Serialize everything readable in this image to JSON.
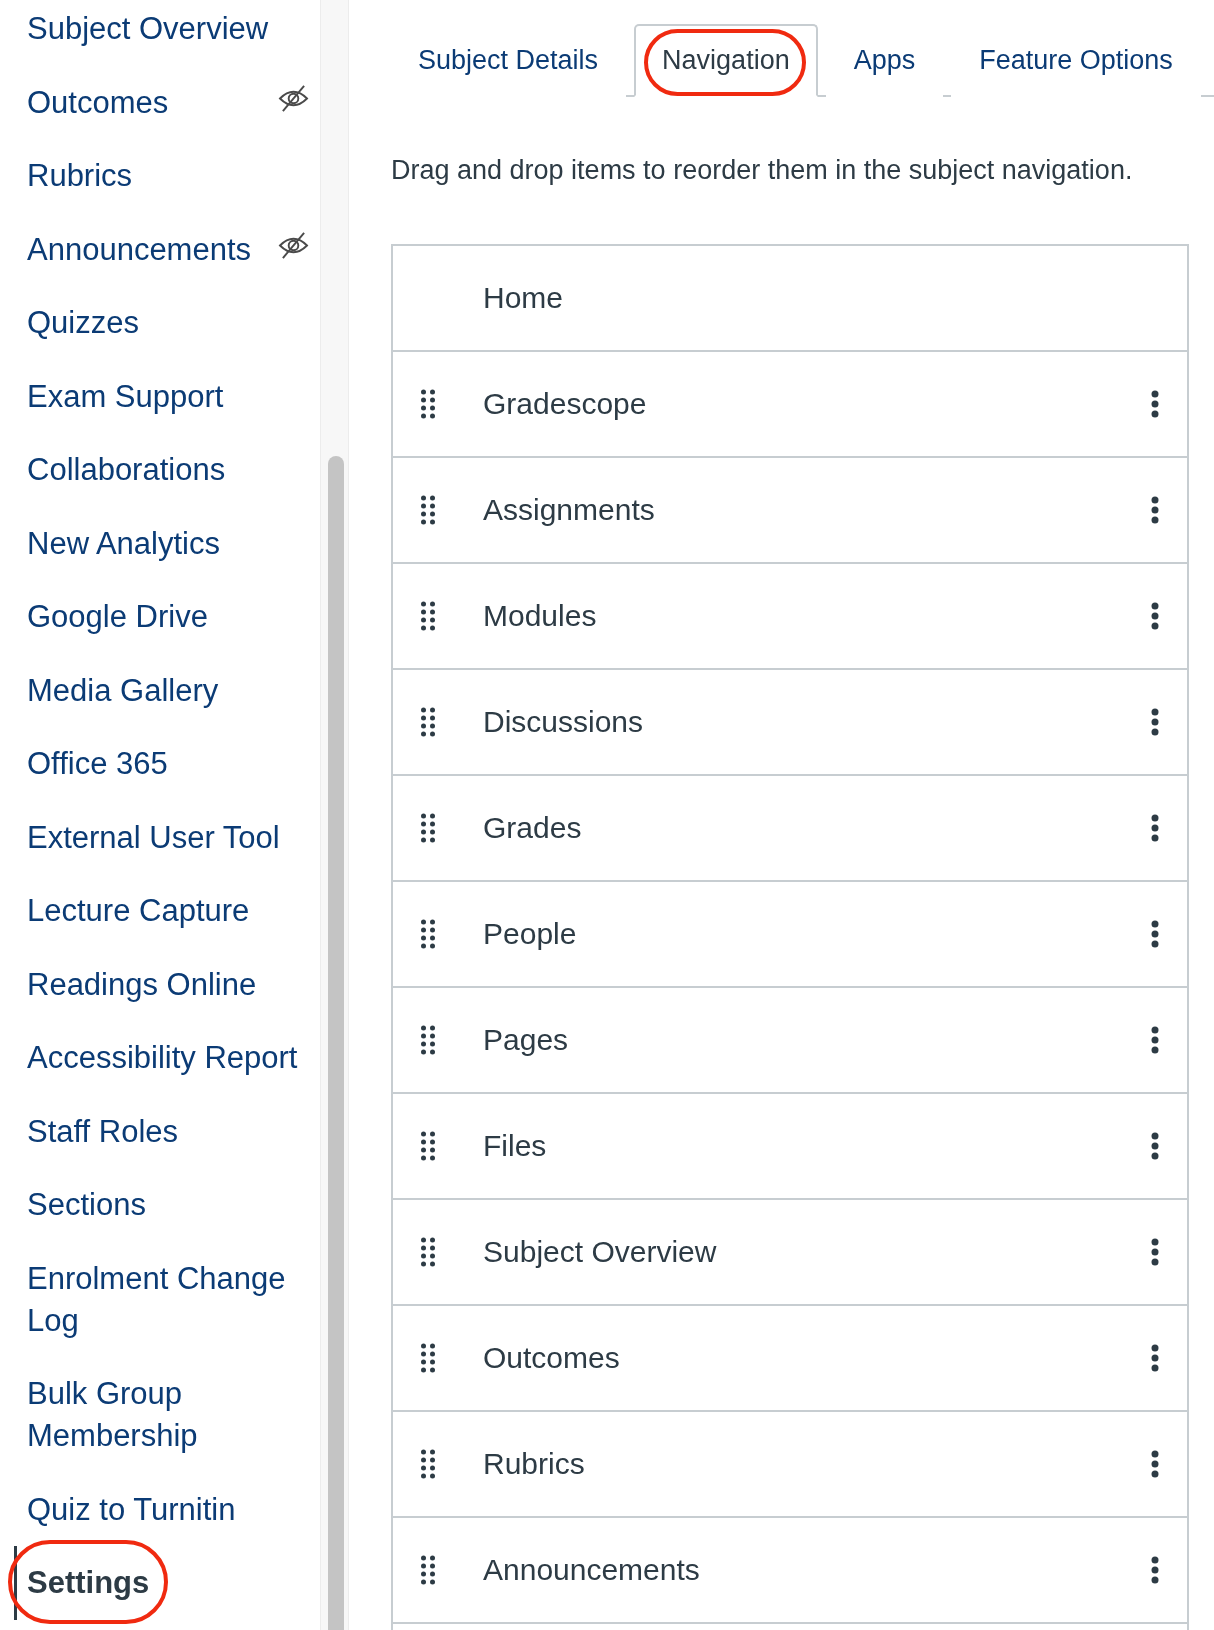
{
  "sidebar": {
    "items": [
      {
        "label": "Subject Overview",
        "hidden": false,
        "selected": false,
        "circled": false
      },
      {
        "label": "Outcomes",
        "hidden": true,
        "selected": false,
        "circled": false
      },
      {
        "label": "Rubrics",
        "hidden": false,
        "selected": false,
        "circled": false
      },
      {
        "label": "Announcements",
        "hidden": true,
        "selected": false,
        "circled": false
      },
      {
        "label": "Quizzes",
        "hidden": false,
        "selected": false,
        "circled": false
      },
      {
        "label": "Exam Support",
        "hidden": false,
        "selected": false,
        "circled": false
      },
      {
        "label": "Collaborations",
        "hidden": false,
        "selected": false,
        "circled": false
      },
      {
        "label": "New Analytics",
        "hidden": false,
        "selected": false,
        "circled": false
      },
      {
        "label": "Google Drive",
        "hidden": false,
        "selected": false,
        "circled": false
      },
      {
        "label": "Media Gallery",
        "hidden": false,
        "selected": false,
        "circled": false
      },
      {
        "label": "Office 365",
        "hidden": false,
        "selected": false,
        "circled": false
      },
      {
        "label": "External User Tool",
        "hidden": false,
        "selected": false,
        "circled": false
      },
      {
        "label": "Lecture Capture",
        "hidden": false,
        "selected": false,
        "circled": false
      },
      {
        "label": "Readings Online",
        "hidden": false,
        "selected": false,
        "circled": false
      },
      {
        "label": "Accessibility Report",
        "hidden": false,
        "selected": false,
        "circled": false
      },
      {
        "label": "Staff Roles",
        "hidden": false,
        "selected": false,
        "circled": false
      },
      {
        "label": "Sections",
        "hidden": false,
        "selected": false,
        "circled": false
      },
      {
        "label": "Enrolment Change Log",
        "hidden": false,
        "selected": false,
        "circled": false
      },
      {
        "label": "Bulk Group Membership",
        "hidden": false,
        "selected": false,
        "circled": false
      },
      {
        "label": "Quiz to Turnitin",
        "hidden": false,
        "selected": false,
        "circled": false
      },
      {
        "label": "Settings",
        "hidden": false,
        "selected": true,
        "circled": true
      }
    ]
  },
  "tabs": [
    {
      "label": "Subject Details",
      "selected": false,
      "circled": false
    },
    {
      "label": "Navigation",
      "selected": true,
      "circled": true
    },
    {
      "label": "Apps",
      "selected": false,
      "circled": false
    },
    {
      "label": "Feature Options",
      "selected": false,
      "circled": false
    }
  ],
  "description": "Drag and drop items to reorder them in the subject navigation.",
  "navigation_items": [
    {
      "label": "Home",
      "draggable": false
    },
    {
      "label": "Gradescope",
      "draggable": true
    },
    {
      "label": "Assignments",
      "draggable": true
    },
    {
      "label": "Modules",
      "draggable": true
    },
    {
      "label": "Discussions",
      "draggable": true
    },
    {
      "label": "Grades",
      "draggable": true
    },
    {
      "label": "People",
      "draggable": true
    },
    {
      "label": "Pages",
      "draggable": true
    },
    {
      "label": "Files",
      "draggable": true
    },
    {
      "label": "Subject Overview",
      "draggable": true
    },
    {
      "label": "Outcomes",
      "draggable": true
    },
    {
      "label": "Rubrics",
      "draggable": true
    },
    {
      "label": "Announcements",
      "draggable": true
    }
  ]
}
